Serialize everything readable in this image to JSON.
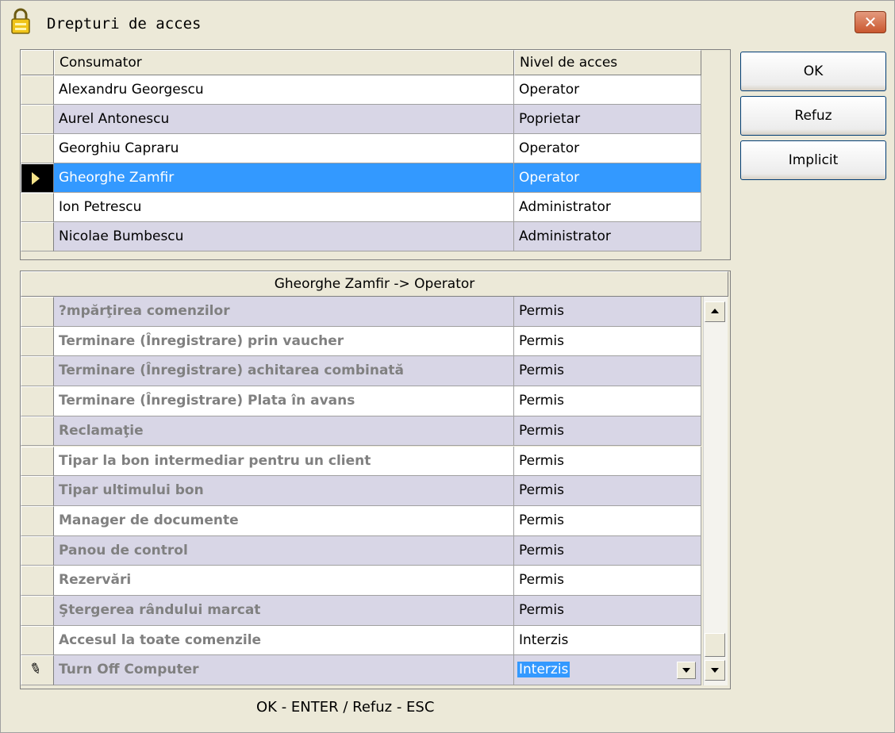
{
  "window": {
    "title": "Drepturi de acces"
  },
  "users": {
    "headers": [
      "Consumator",
      "Nivel de acces"
    ],
    "rows": [
      {
        "name": "Alexandru Georgescu",
        "level": "Operator"
      },
      {
        "name": "Aurel Antonescu",
        "level": "Poprietar"
      },
      {
        "name": "Georghiu Capraru",
        "level": "Operator"
      },
      {
        "name": "Gheorghe Zamfir",
        "level": "Operator"
      },
      {
        "name": "Ion Petrescu",
        "level": "Administrator"
      },
      {
        "name": "Nicolae Bumbescu",
        "level": "Administrator"
      }
    ],
    "selected_index": 3
  },
  "permissions": {
    "header": "Gheorghe Zamfir -> Operator",
    "rows": [
      {
        "name": "?mpărţirea comenzilor",
        "value": "Permis"
      },
      {
        "name": "Terminare (Înregistrare) prin vaucher",
        "value": "Permis"
      },
      {
        "name": "Terminare (Înregistrare) achitarea combinată",
        "value": "Permis"
      },
      {
        "name": "Terminare (Înregistrare) Plata în avans",
        "value": "Permis"
      },
      {
        "name": "Reclamaţie",
        "value": "Permis"
      },
      {
        "name": "Tipar la bon intermediar pentru un client",
        "value": "Permis"
      },
      {
        "name": "Tipar ultimului bon",
        "value": "Permis"
      },
      {
        "name": "Manager de documente",
        "value": "Permis"
      },
      {
        "name": "Panou de control",
        "value": "Permis"
      },
      {
        "name": "Rezervări",
        "value": "Permis"
      },
      {
        "name": "Ştergerea rândului marcat",
        "value": "Permis"
      },
      {
        "name": "Accesul la toate comenzile",
        "value": "Interzis"
      },
      {
        "name": "Turn Off Computer",
        "value": "Interzis"
      }
    ],
    "editing_index": 12
  },
  "buttons": {
    "ok": "OK",
    "cancel": "Refuz",
    "default": "Implicit"
  },
  "footer": "OK - ENTER / Refuz - ESC",
  "colors": {
    "selection": "#3399ff",
    "alt_row": "#d8d6e6",
    "window_bg": "#ECE9D8"
  }
}
